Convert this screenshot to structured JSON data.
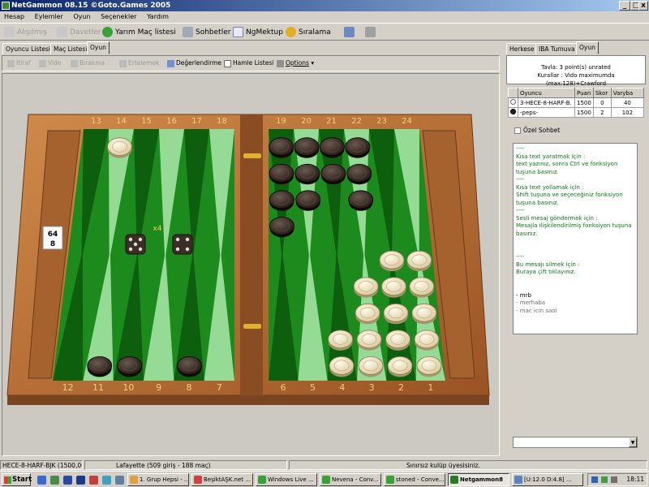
{
  "window": {
    "title": "NetGammon 08.15 ©Goto.Games 2005",
    "controls": {
      "minimize": "_",
      "maximize": "□",
      "close": "x"
    }
  },
  "menu": [
    "Hesap",
    "Eylemler",
    "Oyun",
    "Seçenekler",
    "Yardım"
  ],
  "toolbar": {
    "items": [
      {
        "label": "Alışılmış",
        "enabled": false
      },
      {
        "label": "Davetler",
        "enabled": false
      },
      {
        "label": "Yarım Maç listesi",
        "enabled": true
      },
      {
        "label": "Sohbetler",
        "enabled": true
      },
      {
        "label": "NgMektup",
        "enabled": true
      },
      {
        "label": "Sıralama",
        "enabled": true
      }
    ]
  },
  "left_tabs": [
    "Oyuncu Listesi",
    "Maç Listesi",
    "Oyun"
  ],
  "left_active_tab": "Oyun",
  "game_toolbar": [
    {
      "label": "İtiraf",
      "enabled": false
    },
    {
      "label": "Vide",
      "enabled": false
    },
    {
      "label": "Bırakma",
      "enabled": false
    },
    {
      "label": "Ertelemek",
      "enabled": false
    },
    {
      "label": "Değerlendirme",
      "enabled": true
    },
    {
      "label": "Hamle Listesi",
      "enabled": true
    },
    {
      "label": "Options",
      "enabled": true
    }
  ],
  "board": {
    "top_labels": [
      "13",
      "14",
      "15",
      "16",
      "17",
      "18",
      "19",
      "20",
      "21",
      "22",
      "23",
      "24"
    ],
    "bottom_labels": [
      "12",
      "11",
      "10",
      "9",
      "8",
      "7",
      "6",
      "5",
      "4",
      "3",
      "2",
      "1"
    ],
    "cube": {
      "top": "64",
      "bottom": "8"
    },
    "dice": [
      5,
      4
    ],
    "dice_multiplier": "x4",
    "colors": {
      "felt": "#1d8a1d",
      "wood": "#b76a30",
      "dark_point": "#0c5a0c",
      "light_point": "#9fe19f",
      "light_checker": "#f3ead0",
      "dark_checker": "#3a2a22"
    },
    "points": {
      "1": {
        "color": "light",
        "count": 5
      },
      "2": {
        "color": "light",
        "count": 5
      },
      "3": {
        "color": "light",
        "count": 4
      },
      "4": {
        "color": "light",
        "count": 2
      },
      "8": {
        "color": "dark",
        "count": 1
      },
      "10": {
        "color": "dark",
        "count": 1
      },
      "11": {
        "color": "dark",
        "count": 1
      },
      "14": {
        "color": "light",
        "count": 1
      },
      "19": {
        "color": "dark",
        "count": 4
      },
      "20": {
        "color": "dark",
        "count": 3
      },
      "21": {
        "color": "dark",
        "count": 2
      },
      "22": {
        "color": "dark",
        "count": 3
      }
    }
  },
  "right_tabs": [
    "Herkese",
    "IBA Turnuva",
    "Oyun"
  ],
  "right_active_tab": "Oyun",
  "match_info": {
    "line1": "Tavla: 3 point(s) unrated",
    "line2": "Kurallar : Vido maximumda (max:128)+Crawford"
  },
  "players_table": {
    "headers": [
      "Oyuncu",
      "Puan",
      "Skor",
      "Varyba"
    ],
    "rows": [
      {
        "name": "3-HECE-8-HARF-B.",
        "puan": "1500",
        "skor": "0",
        "varyba": "40"
      },
      {
        "name": "-peps-",
        "puan": "1500",
        "skor": "2",
        "varyba": "102"
      }
    ]
  },
  "private_chat_label": "Özel Sohbet",
  "chat_lines": [
    {
      "text": "----",
      "tone": "green"
    },
    {
      "text": "Kısa text yaratmak için :",
      "tone": "green"
    },
    {
      "text": "text yazınız, sonra Ctrl ve fonksiyon tuşuna basınız.",
      "tone": "green"
    },
    {
      "text": "----",
      "tone": "green"
    },
    {
      "text": "Kısa text yollamak için :",
      "tone": "green"
    },
    {
      "text": "Shift tuşuna ve seçeceğiniz fonksiyon tuşuna basınız.",
      "tone": "green"
    },
    {
      "text": "----",
      "tone": "green"
    },
    {
      "text": "Sesli mesaj göndermek için :",
      "tone": "green"
    },
    {
      "text": "Mesajla ilişkilendirilmiş fonksiyon tuşuna basınız.",
      "tone": "green"
    },
    {
      "text": " ",
      "tone": "green"
    },
    {
      "text": " ",
      "tone": "green"
    },
    {
      "text": "----",
      "tone": "green"
    },
    {
      "text": "Bu mesajı silmek için :",
      "tone": "green"
    },
    {
      "text": "Buraya çift tıklayınız.",
      "tone": "green"
    },
    {
      "text": " ",
      "tone": "green"
    },
    {
      "text": " ",
      "tone": "green"
    },
    {
      "text": "- mrb",
      "tone": "black"
    },
    {
      "text": "- merhaba",
      "tone": "gray"
    },
    {
      "text": "- mac icin saol",
      "tone": "gray"
    }
  ],
  "status": [
    "HECE-8-HARF-BJK (1500,00 -",
    "Lafayette (509 giriş - 188 maç)",
    "Sınırsız kulüp üyesisiniz."
  ],
  "taskbar": {
    "start": "Start",
    "tasks": [
      {
        "label": "1. Grup Hepsi - ...",
        "active": false
      },
      {
        "label": "BeşiktAŞK.net ...",
        "active": false
      },
      {
        "label": "Windows Live ...",
        "active": false
      },
      {
        "label": "Nevena - Conv...",
        "active": false
      },
      {
        "label": "stoned - Conve...",
        "active": false
      },
      {
        "label": "Netgammon8",
        "active": true
      },
      {
        "label": "[U:12.0 D:4.8] ...",
        "active": false
      }
    ],
    "tray_time": "18:11"
  }
}
